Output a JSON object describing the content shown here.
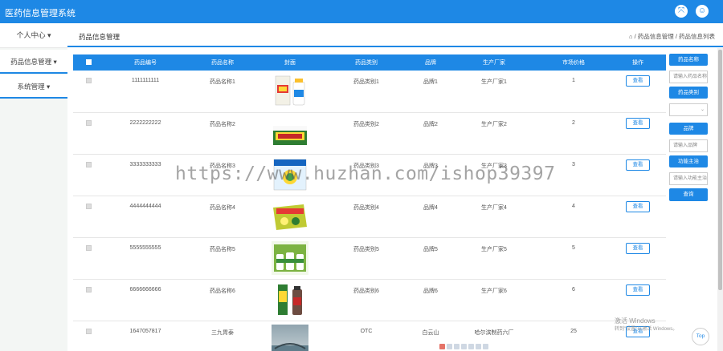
{
  "header": {
    "title": "医药信息管理系统",
    "icons": [
      "fullscreen-icon",
      "user-icon"
    ]
  },
  "sidebar": {
    "user_label": "个人中心",
    "items": [
      {
        "label": "药品信息管理"
      },
      {
        "label": "系统管理"
      }
    ]
  },
  "page": {
    "title": "药品信息管理",
    "breadcrumb": "/ 药品信息管理 / 药品信息列表"
  },
  "table": {
    "columns": [
      "药品编号",
      "药品名称",
      "封面",
      "药品类别",
      "品牌",
      "生产厂家",
      "市场价格",
      "操作"
    ],
    "view_label": "查看",
    "rows": [
      {
        "code": "1111111111",
        "name": "药品名称1",
        "category": "药品类别1",
        "brand": "品牌1",
        "maker": "生产厂家1",
        "price": "1"
      },
      {
        "code": "2222222222",
        "name": "药品名称2",
        "category": "药品类别2",
        "brand": "品牌2",
        "maker": "生产厂家2",
        "price": "2"
      },
      {
        "code": "3333333333",
        "name": "药品名称3",
        "category": "药品类别3",
        "brand": "品牌3",
        "maker": "生产厂家3",
        "price": "3"
      },
      {
        "code": "4444444444",
        "name": "药品名称4",
        "category": "药品类别4",
        "brand": "品牌4",
        "maker": "生产厂家4",
        "price": "4"
      },
      {
        "code": "5555555555",
        "name": "药品名称5",
        "category": "药品类别5",
        "brand": "品牌5",
        "maker": "生产厂家5",
        "price": "5"
      },
      {
        "code": "6666666666",
        "name": "药品名称6",
        "category": "药品类别6",
        "brand": "品牌6",
        "maker": "生产厂家6",
        "price": "6"
      },
      {
        "code": "1647057817",
        "name": "三九胃泰",
        "category": "OTC",
        "brand": "白云山",
        "maker": "哈尔滨制药六厂",
        "price": "25"
      }
    ]
  },
  "filter": {
    "name_label": "药品名称",
    "name_placeholder": "请输入药品名称",
    "category_label": "药品类别",
    "brand_label": "品牌",
    "brand_placeholder": "请输入品牌",
    "function_label": "功能主治",
    "function_placeholder": "请输入功能主治",
    "search_label": "查询"
  },
  "watermark": "https://www.huzhan.com/ishop39397",
  "windows": {
    "line1": "激活 Windows",
    "line2": "转到\"设置\"以激活 Windows。"
  },
  "top_button": "Top",
  "colors": {
    "primary": "#1e88e5"
  }
}
